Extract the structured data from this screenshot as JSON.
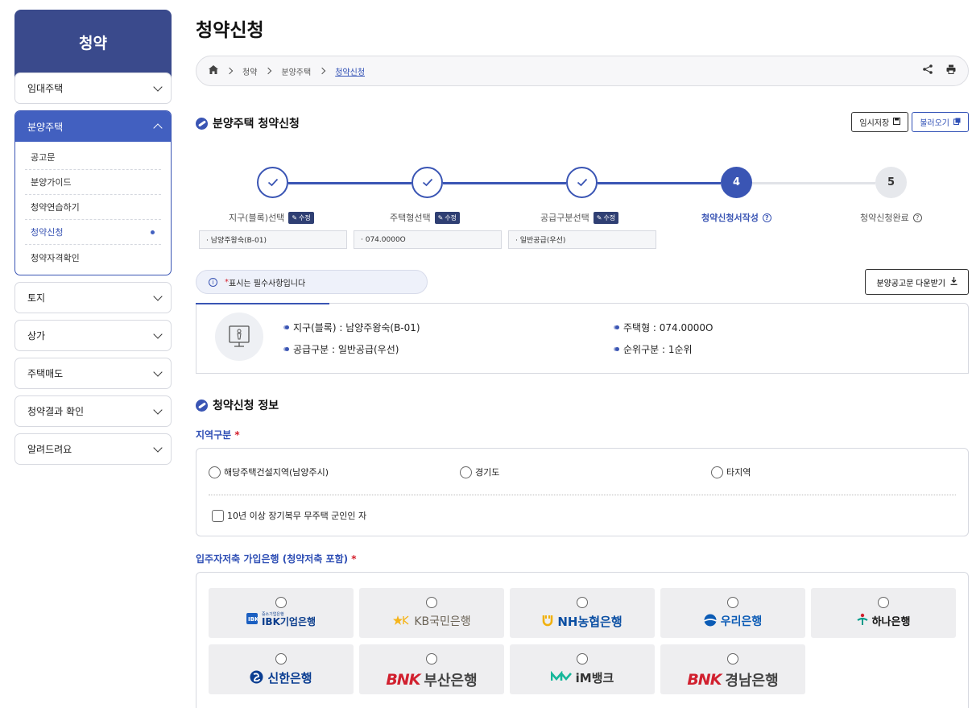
{
  "sidebar": {
    "title": "청약",
    "menu_1": "임대주택",
    "active_group": "분양주택",
    "sub_items": [
      "공고문",
      "분양가이드",
      "청약연습하기",
      "청약신청",
      "청약자격확인"
    ],
    "menu_rest": [
      "토지",
      "상가",
      "주택매도",
      "청약결과 확인",
      "알려드려요"
    ]
  },
  "page": {
    "title": "청약신청"
  },
  "breadcrumb": {
    "items": [
      "청약",
      "분양주택",
      "청약신청"
    ]
  },
  "section1": {
    "title": "분양주택 청약신청"
  },
  "buttons": {
    "temp_save": "임시저장",
    "load": "불러오기",
    "download": "분양공고문 다운받기"
  },
  "steps": [
    {
      "number": "1",
      "label": "지구(블록)선택",
      "edit": "수정",
      "value": "· 남양주왕숙(B-01)",
      "state": "done"
    },
    {
      "number": "2",
      "label": "주택형선택",
      "edit": "수정",
      "value": "· 074.0000O",
      "state": "done"
    },
    {
      "number": "3",
      "label": "공급구분선택",
      "edit": "수정",
      "value": "· 일반공급(우선)",
      "state": "done"
    },
    {
      "number": "4",
      "label": "청약신청서작성",
      "state": "current"
    },
    {
      "number": "5",
      "label": "청약신청완료",
      "state": "todo"
    }
  ],
  "notice": {
    "mark": "*",
    "text": "표시는 필수사항입니다"
  },
  "summary": {
    "district": "지구(블록) : 남양주왕숙(B-01)",
    "house_type": "주택형 : 074.0000O",
    "supply": "공급구분 : 일반공급(우선)",
    "rank": "순위구분 : 1순위"
  },
  "section2": {
    "title": "청약신청 정보"
  },
  "region": {
    "label": "지역구분",
    "required": "*",
    "options": [
      "해당주택건설지역(남양주시)",
      "경기도",
      "타지역"
    ],
    "checkbox": "10년 이상 장기복무 무주택 군인인 자"
  },
  "bank": {
    "label": "입주자저축 가입은행 (청약저축 포함)",
    "required": "*",
    "ibk_small": "중소기업은행",
    "banks": [
      {
        "name": "IBK기업은행",
        "color": "#0b3d8c"
      },
      {
        "name": "KB국민은행",
        "color": "#6b6356"
      },
      {
        "name": "NH농협은행",
        "color": "#0b4fa3"
      },
      {
        "name": "우리은행",
        "color": "#0b5bb5"
      },
      {
        "name": "하나은행",
        "color": "#111111"
      },
      {
        "name": "신한은행",
        "color": "#0a3d91"
      },
      {
        "name": "부산은행",
        "color": "#d1202f"
      },
      {
        "name": "iM뱅크",
        "color": "#333333"
      },
      {
        "name": "경남은행",
        "color": "#d1202f"
      }
    ]
  }
}
